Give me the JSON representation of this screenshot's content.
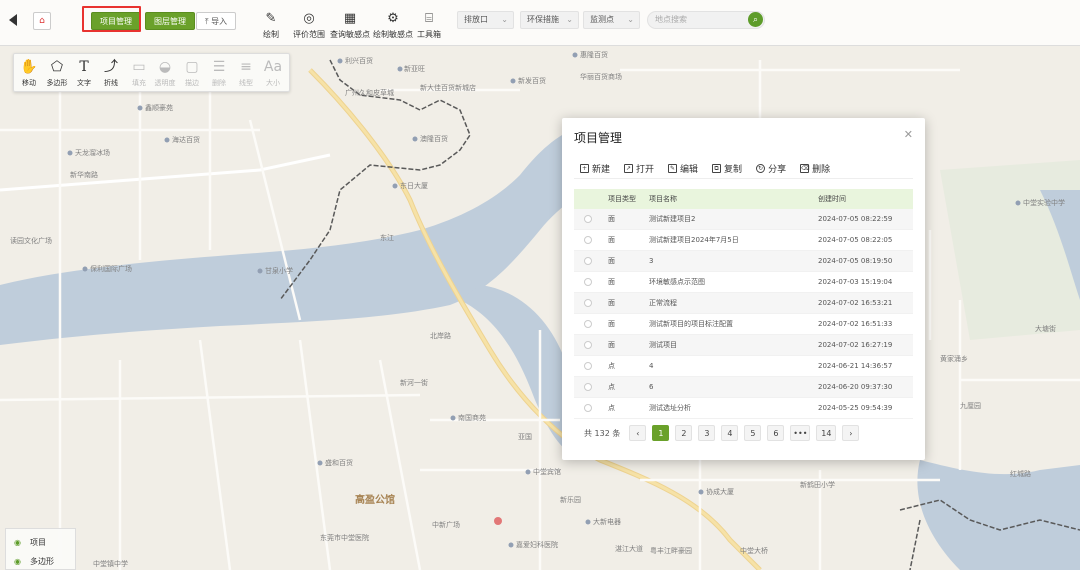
{
  "toolbar": {
    "project_manage": "项目管理",
    "marker_manage": "图层管理",
    "import": "导入",
    "tools": [
      {
        "label": "绘制",
        "icon": "pencil-icon"
      },
      {
        "label": "评价范围",
        "icon": "target-icon"
      },
      {
        "label": "查询敏感点",
        "icon": "building-search-icon"
      },
      {
        "label": "绘制敏感点",
        "icon": "gear-marker-icon"
      },
      {
        "label": "工具箱",
        "icon": "toolbox-icon"
      }
    ],
    "selects": [
      {
        "value": "排放口"
      },
      {
        "value": "环保措施"
      },
      {
        "value": "监测点"
      }
    ],
    "search_placeholder": "地点搜索"
  },
  "palette": [
    {
      "label": "移动",
      "icon": "hand-icon",
      "enabled": true
    },
    {
      "label": "多边形",
      "icon": "polygon-icon",
      "enabled": true
    },
    {
      "label": "文字",
      "icon": "text-icon",
      "enabled": true
    },
    {
      "label": "折线",
      "icon": "polyline-icon",
      "enabled": true
    },
    {
      "label": "填充",
      "icon": "fill-icon",
      "enabled": false
    },
    {
      "label": "透明度",
      "icon": "opacity-icon",
      "enabled": false
    },
    {
      "label": "描边",
      "icon": "stroke-icon",
      "enabled": false
    },
    {
      "label": "删除",
      "icon": "delete-icon",
      "enabled": false
    },
    {
      "label": "线型",
      "icon": "linetype-icon",
      "enabled": false
    },
    {
      "label": "大小",
      "icon": "font-size-icon",
      "enabled": false
    }
  ],
  "layers": [
    {
      "label": "项目"
    },
    {
      "label": "多边形"
    }
  ],
  "modal": {
    "title": "项目管理",
    "actions": [
      {
        "label": "新建",
        "icon": "new-icon"
      },
      {
        "label": "打开",
        "icon": "open-icon"
      },
      {
        "label": "编辑",
        "icon": "edit-icon"
      },
      {
        "label": "复制",
        "icon": "copy-icon"
      },
      {
        "label": "分享",
        "icon": "share-icon"
      },
      {
        "label": "删除",
        "icon": "trash-icon"
      }
    ],
    "columns": [
      "项目类型",
      "项目名称",
      "创建时间"
    ],
    "rows": [
      {
        "type": "面",
        "name": "测试新建项目2",
        "date": "2024-07-05 08:22:59"
      },
      {
        "type": "面",
        "name": "测试新建项目2024年7月5日",
        "date": "2024-07-05 08:22:05"
      },
      {
        "type": "面",
        "name": "3",
        "date": "2024-07-05 08:19:50"
      },
      {
        "type": "面",
        "name": "环境敏感点示范图",
        "date": "2024-07-03 15:19:04"
      },
      {
        "type": "面",
        "name": "正常流程",
        "date": "2024-07-02 16:53:21"
      },
      {
        "type": "面",
        "name": "测试新项目的项目标注配置",
        "date": "2024-07-02 16:51:33"
      },
      {
        "type": "面",
        "name": "测试项目",
        "date": "2024-07-02 16:27:19"
      },
      {
        "type": "点",
        "name": "4",
        "date": "2024-06-21 14:36:57"
      },
      {
        "type": "点",
        "name": "6",
        "date": "2024-06-20 09:37:30"
      },
      {
        "type": "点",
        "name": "测试选址分析",
        "date": "2024-05-25 09:54:39"
      }
    ],
    "pagination": {
      "total": "共 132 条",
      "prev": "‹",
      "next": "›",
      "pages": [
        "1",
        "2",
        "3",
        "4",
        "5",
        "6",
        "•••",
        "14"
      ],
      "current": "1"
    }
  },
  "map_labels": {
    "l1": "利兴百货",
    "l2": "新亚旺",
    "l3": "惠隆百货",
    "l4": "华丽百货商场",
    "l5": "广州久和皮草城",
    "l6": "新大佳百货新城店",
    "l7": "新发百货",
    "l8": "鑫顺豪苑",
    "l9": "海达百货",
    "l10": "澳隆百货",
    "l11": "天龙溜冰场",
    "l12": "新华南路",
    "l13": "东日大厦",
    "l14": "读园文化广场",
    "l15": "保利国际广场",
    "l16": "甘泉小学",
    "l17": "东江",
    "l18": "北岸路",
    "l19": "新河一街",
    "l20": "南国商苑",
    "l21": "亚国",
    "l22": "盛和百货",
    "l23": "高盈公馆",
    "l24": "中堂实验中学",
    "l25": "大塘街",
    "l26": "黄家涌乡",
    "l27": "九厘园",
    "l28": "东莞市中堂医院",
    "l29": "中新广场",
    "l30": "嘉爱妇科医院",
    "l31": "大新电器",
    "l32": "新乐园",
    "l33": "协成大厦",
    "l34": "中堂宾馆",
    "l35": "湛江大道",
    "l36": "粤丰江畔豪园",
    "l37": "中堂大桥",
    "l38": "中堂镇中学",
    "l39": "新鹤田小学",
    "l40": "红城路"
  }
}
